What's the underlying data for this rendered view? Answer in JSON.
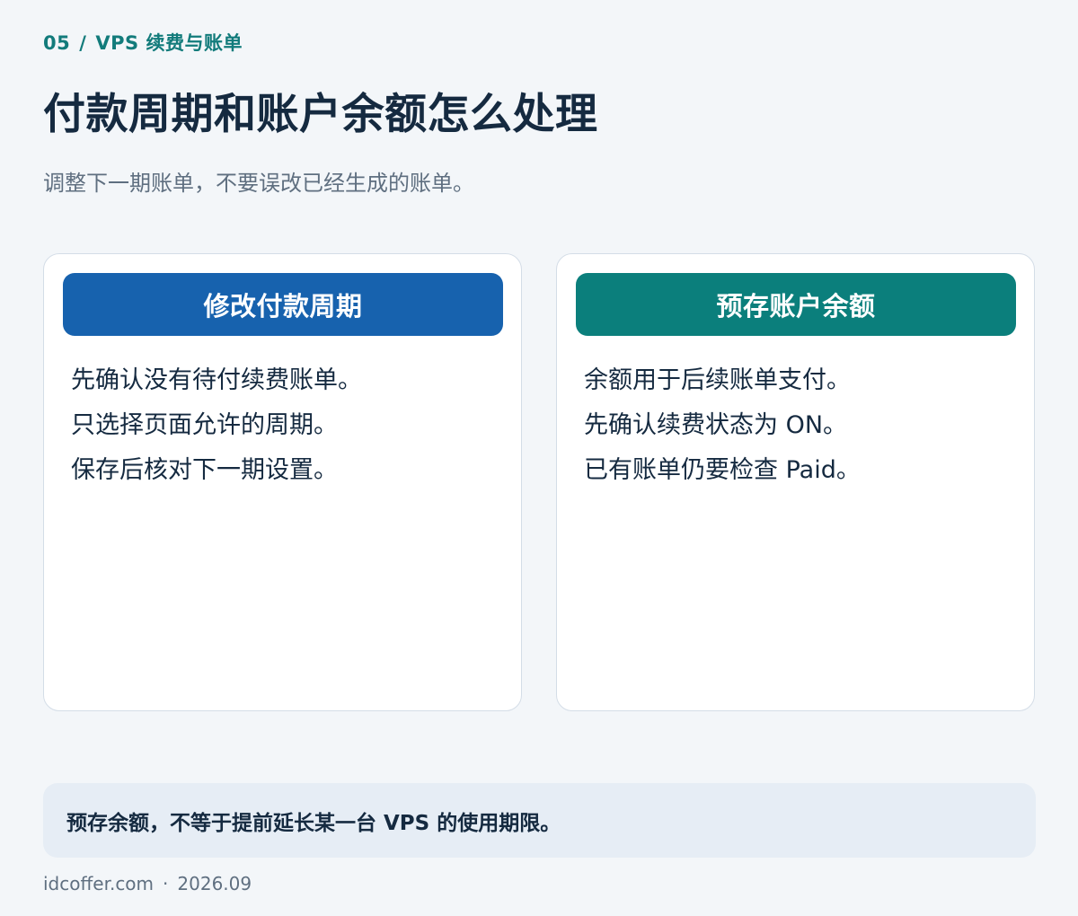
{
  "breadcrumb": {
    "number": "05",
    "separator": "/",
    "section": "VPS 续费与账单"
  },
  "page_title": "付款周期和账户余额怎么处理",
  "subtitle": "调整下一期账单，不要误改已经生成的账单。",
  "cards": [
    {
      "title": "修改付款周期",
      "color": "#1762ae",
      "lines": [
        "先确认没有待付续费账单。",
        "只选择页面允许的周期。",
        "保存后核对下一期设置。"
      ]
    },
    {
      "title": "预存账户余额",
      "color": "#0b7f7c",
      "lines": [
        "余额用于后续账单支付。",
        "先确认续费状态为 ON。",
        "已有账单仍要检查 Paid。"
      ]
    }
  ],
  "note": "预存余额，不等于提前延长某一台 VPS 的使用期限。",
  "footer": {
    "site": "idcoffer.com",
    "separator": "·",
    "date": "2026.09"
  }
}
